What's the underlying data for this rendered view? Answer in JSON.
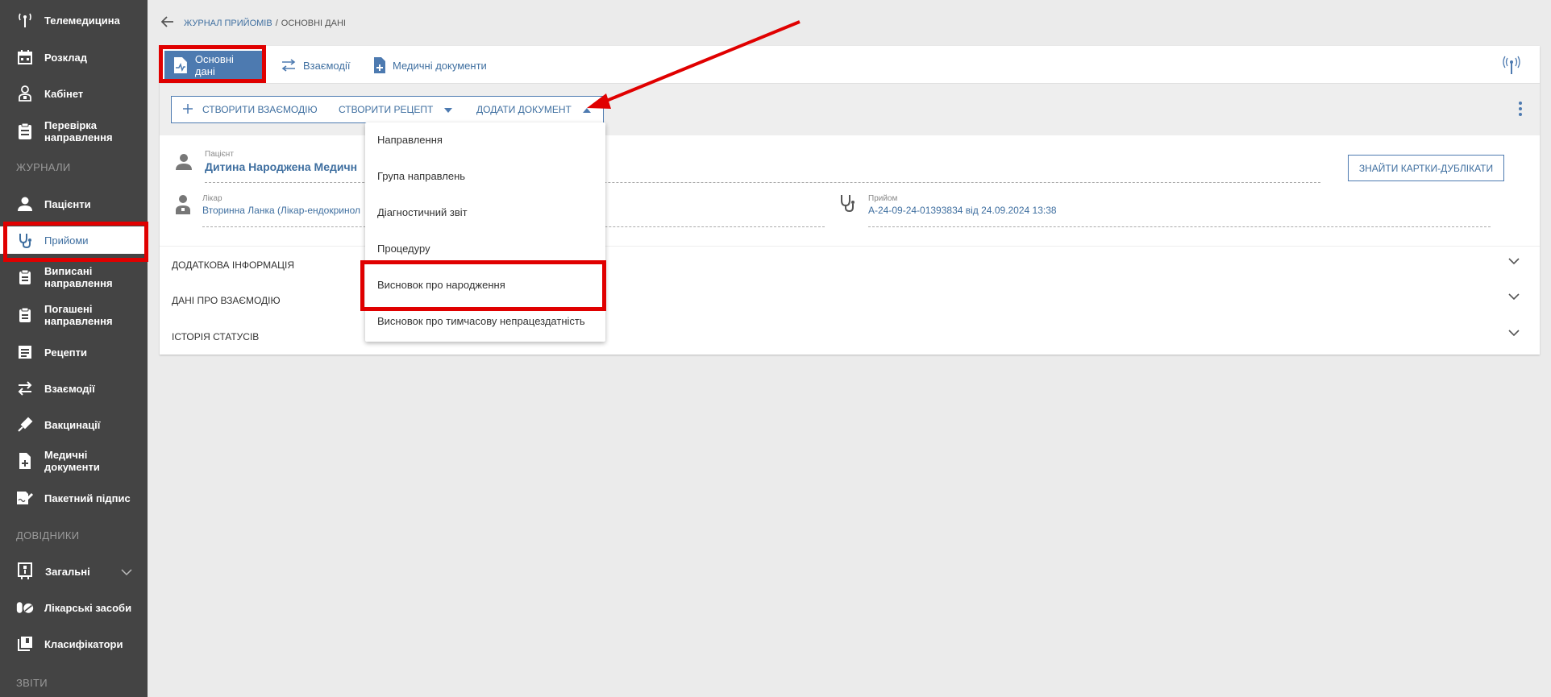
{
  "sidebar": {
    "items": [
      {
        "label": "Телемедицина",
        "icon": "antenna-icon"
      },
      {
        "label": "Розклад",
        "icon": "calendar-icon"
      },
      {
        "label": "Кабінет",
        "icon": "doctor-icon"
      },
      {
        "label": "Перевірка направлення",
        "icon": "clipboard-check-icon"
      }
    ],
    "section_journals": "ЖУРНАЛИ",
    "journals": [
      {
        "label": "Пацієнти",
        "icon": "person-icon"
      },
      {
        "label": "Прийоми",
        "icon": "stethoscope-icon"
      },
      {
        "label": "Виписані направлення",
        "icon": "clipboard-icon"
      },
      {
        "label": "Погашені направлення",
        "icon": "clipboard-icon"
      },
      {
        "label": "Рецепти",
        "icon": "list-icon"
      },
      {
        "label": "Взаємодії",
        "icon": "swap-icon"
      },
      {
        "label": "Вакцинації",
        "icon": "syringe-icon"
      },
      {
        "label": "Медичні документи",
        "icon": "doc-plus-icon"
      },
      {
        "label": "Пакетний підпис",
        "icon": "sign-icon"
      }
    ],
    "section_refs": "ДОВІДНИКИ",
    "refs": [
      {
        "label": "Загальні",
        "icon": "book-icon"
      },
      {
        "label": "Лікарські засоби",
        "icon": "pills-icon"
      },
      {
        "label": "Класифікатори",
        "icon": "library-icon"
      }
    ],
    "section_reports": "ЗВІТИ"
  },
  "breadcrumb": {
    "parent": "Журнал прийомів",
    "separator": "/",
    "current": "Основні дані"
  },
  "tabs": [
    {
      "label": "Основні дані"
    },
    {
      "label": "Взаємодії"
    },
    {
      "label": "Медичні документи"
    }
  ],
  "toolbar": {
    "create_interaction": "Створити взаємодію",
    "create_recipe": "Створити рецепт",
    "add_document": "Додати документ"
  },
  "patient": {
    "label": "Пацієнт",
    "name": "Дитина Народжена Медичн",
    "doctor_label": "Лікар",
    "doctor": "Вторинна Ланка (Лікар-ендокринол",
    "visit_label": "Прийом",
    "visit": "A-24-09-24-01393834 від 24.09.2024 13:38",
    "dup_button": "Знайти картки-дублікати"
  },
  "accordions": [
    {
      "label": "Додаткова інформація"
    },
    {
      "label": "Дані про взаємодію"
    },
    {
      "label": "Історія статусів"
    }
  ],
  "dropdown": {
    "items": [
      "Направлення",
      "Група направлень",
      "Діагностичний звіт",
      "Процедуру",
      "Висновок про народження",
      "Висновок про тимчасову непрацездатність"
    ]
  },
  "colors": {
    "sidebar": "#444444",
    "accent": "#4d7ab0",
    "highlight": "#e00000"
  }
}
